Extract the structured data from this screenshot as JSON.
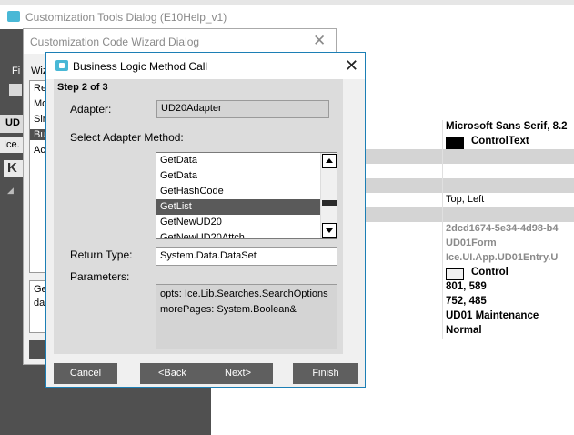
{
  "tools_dialog": {
    "title": "Customization Tools Dialog  (E10Help_v1)",
    "menu_fragment": "Fi",
    "tab_ud": "UD",
    "tab_ice": "Ice.",
    "k_glyph": "K"
  },
  "properties": [
    {
      "value": "Microsoft Sans Serif, 8.2",
      "style": "b",
      "shade": false
    },
    {
      "value": "ControlText",
      "style": "b",
      "shade": false,
      "swatch": "#000000"
    },
    {
      "value": "",
      "style": "",
      "shade": true
    },
    {
      "value": "",
      "style": "",
      "shade": false
    },
    {
      "value": "",
      "style": "",
      "shade": true
    },
    {
      "value": "Top, Left",
      "style": "",
      "shade": false
    },
    {
      "value": "",
      "style": "",
      "shade": true
    },
    {
      "value": "2dcd1674-5e34-4d98-b4",
      "style": "g",
      "shade": false
    },
    {
      "value": "UD01Form",
      "style": "g",
      "shade": false
    },
    {
      "value": "Ice.UI.App.UD01Entry.U",
      "style": "g",
      "shade": false
    },
    {
      "value": "Control",
      "style": "b",
      "shade": false,
      "swatch": "#f0f0f0"
    },
    {
      "value": "801, 589",
      "style": "b",
      "shade": false
    },
    {
      "value": "752, 485",
      "style": "b",
      "shade": false
    },
    {
      "value": "UD01 Maintenance",
      "style": "b",
      "shade": false
    },
    {
      "value": "Normal",
      "style": "b",
      "shade": false
    }
  ],
  "wizard": {
    "title": "Customization Code Wizard Dialog",
    "label": "Wiz",
    "list": [
      "Re",
      "Mo",
      "Sin",
      "Bu",
      "Ac"
    ],
    "desc": [
      "Ge",
      "da"
    ]
  },
  "blm": {
    "title": "Business Logic Method Call",
    "step": "Step 2 of 3",
    "adapter_label": "Adapter:",
    "adapter_value": "UD20Adapter",
    "select_label": "Select Adapter Method:",
    "methods": [
      "GetData",
      "GetData",
      "GetHashCode",
      "GetList",
      "GetNewUD20",
      "GetNewUD20Attch"
    ],
    "selected_method": "GetList",
    "return_label": "Return Type:",
    "return_value": "System.Data.DataSet",
    "params_label": "Parameters:",
    "params": [
      "opts: Ice.Lib.Searches.SearchOptions",
      "morePages: System.Boolean&"
    ],
    "buttons": {
      "cancel": "Cancel",
      "back": "<Back",
      "next": "Next>",
      "finish": "Finish"
    }
  }
}
